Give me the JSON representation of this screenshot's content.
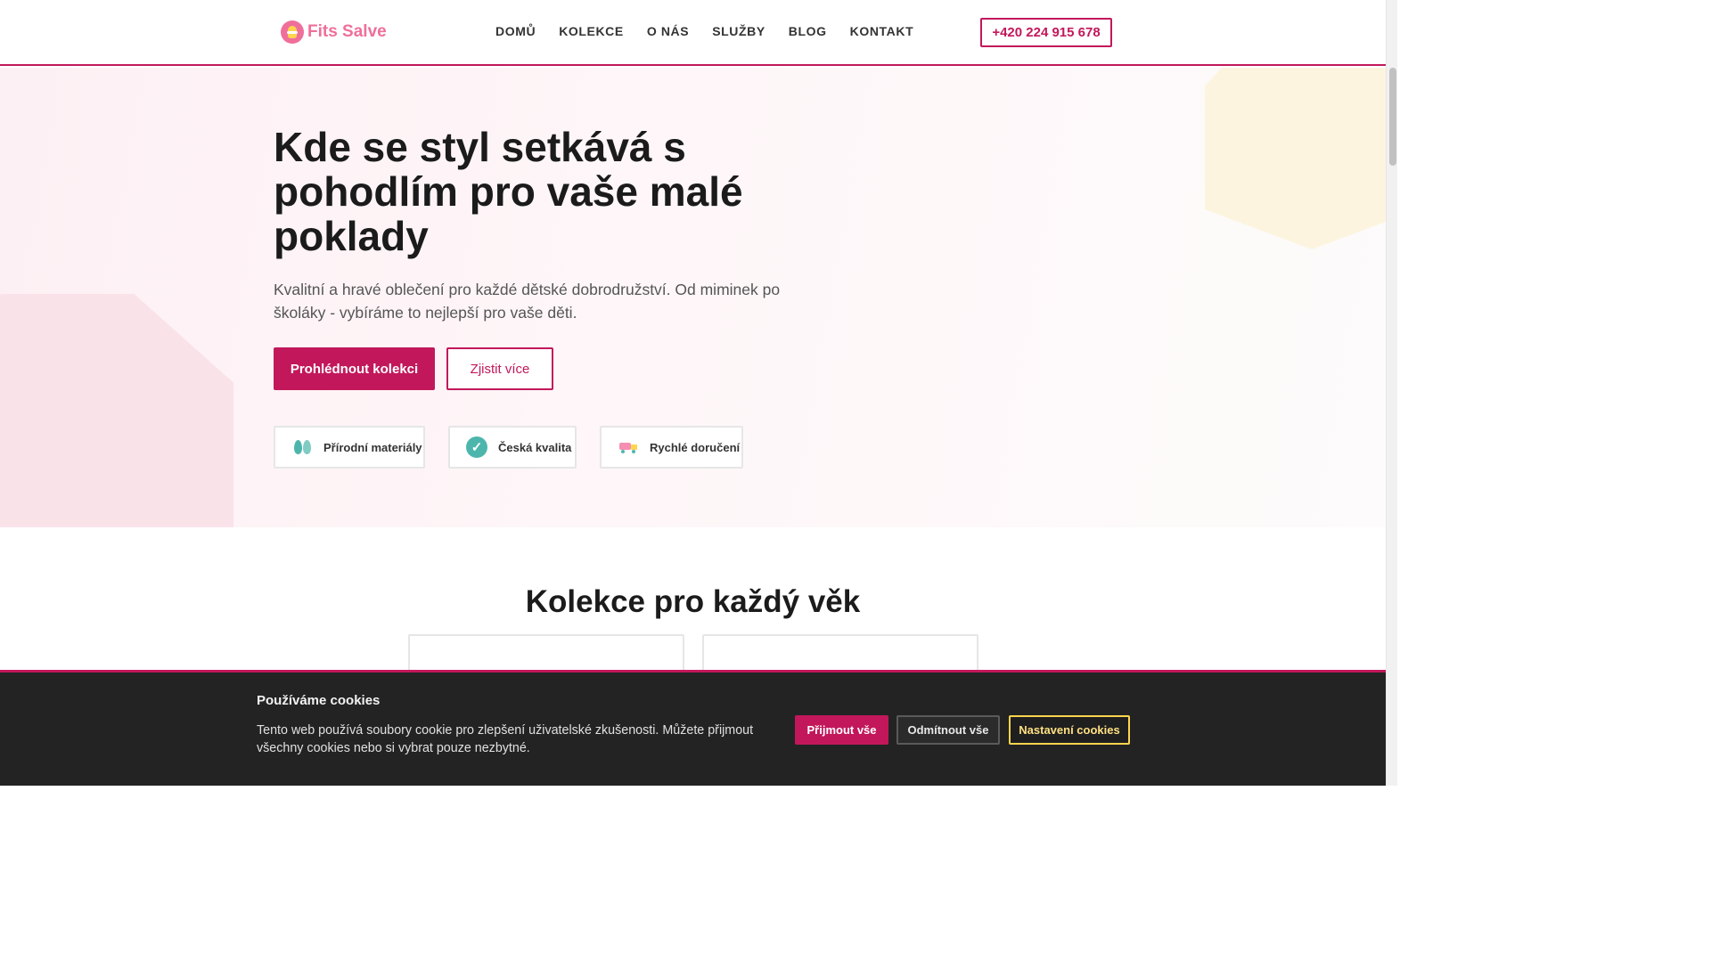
{
  "header": {
    "logo_text": "Fits Salve",
    "nav": [
      "DOMŮ",
      "KOLEKCE",
      "O NÁS",
      "SLUŽBY",
      "BLOG",
      "KONTAKT"
    ],
    "phone": "+420 224 915 678"
  },
  "hero": {
    "title": "Kde se styl setkává s pohodlím pro vaše malé poklady",
    "subtitle": "Kvalitní a hravé oblečení pro každé dětské dobrodružství. Od miminek po školáky - vybíráme to nejlepší pro vaše děti.",
    "primary_button": "Prohlédnout kolekci",
    "secondary_button": "Zjistit více",
    "features": [
      "Přírodní materiály",
      "Česká kvalita",
      "Rychlé doručení"
    ]
  },
  "collections": {
    "title": "Kolekce pro každý věk"
  },
  "cookie": {
    "title": "Používáme cookies",
    "text": "Tento web používá soubory cookie pro zlepšení uživatelské zkušenosti. Můžete přijmout všechny cookies nebo si vybrat pouze nezbytné.",
    "accept": "Přijmout vše",
    "reject": "Odmítnout vše",
    "settings": "Nastavení cookies"
  },
  "colors": {
    "accent": "#c2185b",
    "logo": "#ef6f9a",
    "cookie_bg": "#232323",
    "settings_border": "#ffd54f"
  }
}
